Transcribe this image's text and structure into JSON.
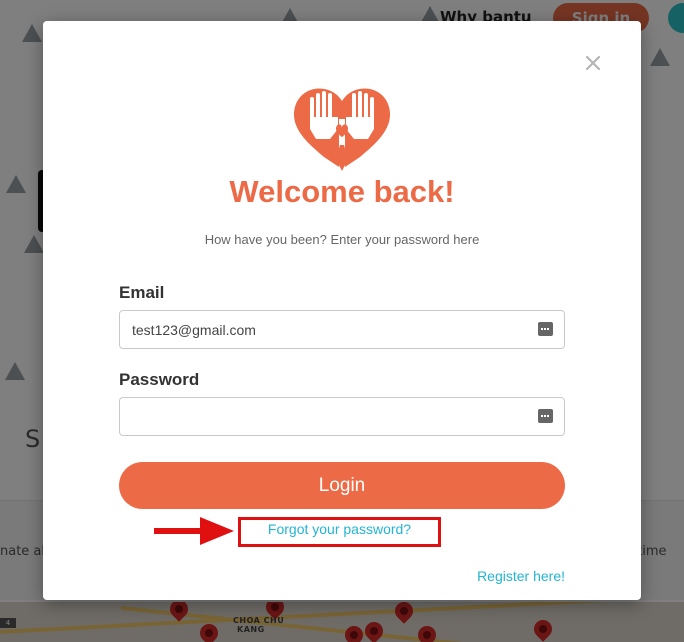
{
  "background": {
    "nav_why": "Why bantu",
    "nav_signin": "Sign in",
    "section_letter": "S",
    "band_left_text": "nate ab",
    "band_right_text": "e time",
    "map_label_line1": "CHOA CHU",
    "map_label_line2": "KANG",
    "map_road_number": "4"
  },
  "modal": {
    "title": "Welcome back!",
    "subtitle": "How have you been? Enter your password here",
    "email_label": "Email",
    "email_value": "test123@gmail.com",
    "password_label": "Password",
    "password_value": "",
    "login_label": "Login",
    "forgot_label": "Forgot your password?",
    "register_label": "Register here!"
  },
  "colors": {
    "brand": "#ec6a46",
    "link": "#23b5d3",
    "highlight": "#e01010"
  },
  "icons": [
    "heart-hands-logo-icon",
    "close-icon",
    "keyboard-icon",
    "arrow-right-icon"
  ]
}
